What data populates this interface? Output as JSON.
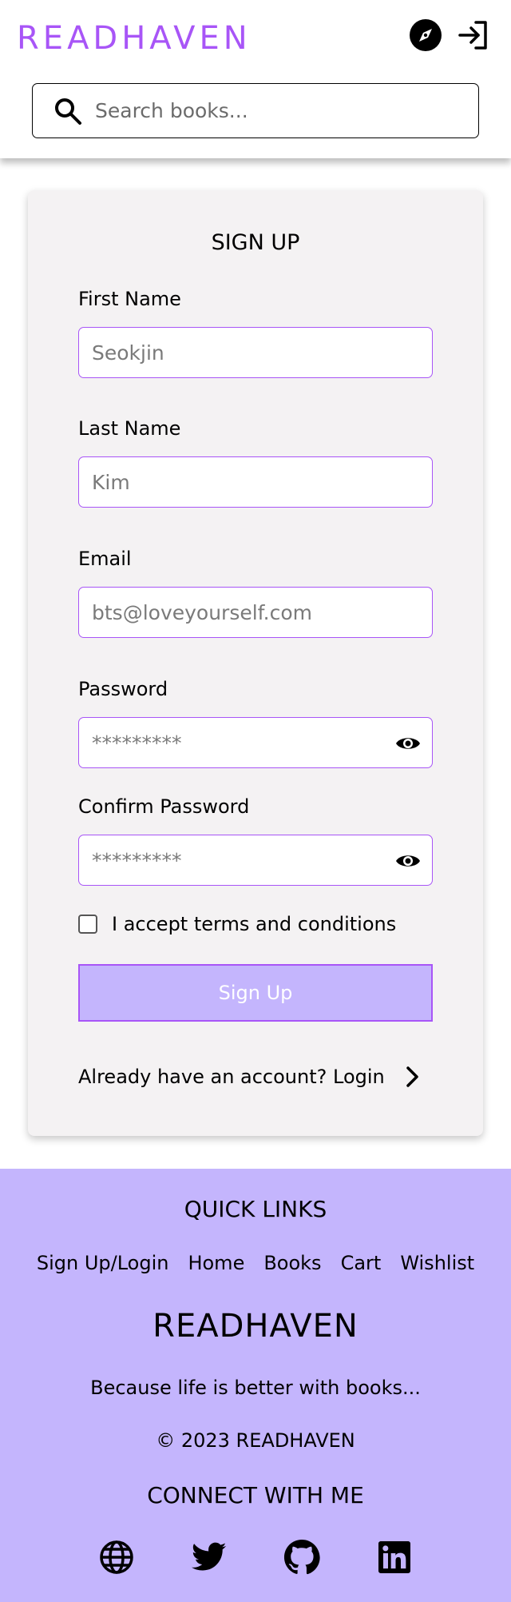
{
  "header": {
    "logo": "READHAVEN",
    "explore_icon": "compass-icon",
    "login_icon": "login-icon",
    "search": {
      "placeholder": "Search books...",
      "icon": "search-icon"
    }
  },
  "form": {
    "title": "SIGN UP",
    "first_name": {
      "label": "First Name",
      "placeholder": "Seokjin"
    },
    "last_name": {
      "label": "Last Name",
      "placeholder": "Kim"
    },
    "email": {
      "label": "Email",
      "placeholder": "bts@loveyourself.com"
    },
    "password": {
      "label": "Password",
      "placeholder": "*********"
    },
    "confirm_password": {
      "label": "Confirm Password",
      "placeholder": "*********"
    },
    "terms_label": "I accept terms and conditions",
    "submit_label": "Sign Up",
    "login_prompt": "Already have an account? Login"
  },
  "footer": {
    "quick_links_title": "QUICK LINKS",
    "links": [
      "Sign Up/Login",
      "Home",
      "Books",
      "Cart",
      "Wishlist"
    ],
    "brand": "READHAVEN",
    "tagline": "Because life is better with books...",
    "copyright": "© 2023 READHAVEN",
    "connect_title": "CONNECT WITH ME",
    "socials": [
      "globe-icon",
      "twitter-icon",
      "github-icon",
      "linkedin-icon"
    ]
  },
  "colors": {
    "accent": "#a855f7",
    "button_fill": "#c4b5fd",
    "footer_bg": "#c4b5fd",
    "card_bg": "#f4f2f3"
  }
}
